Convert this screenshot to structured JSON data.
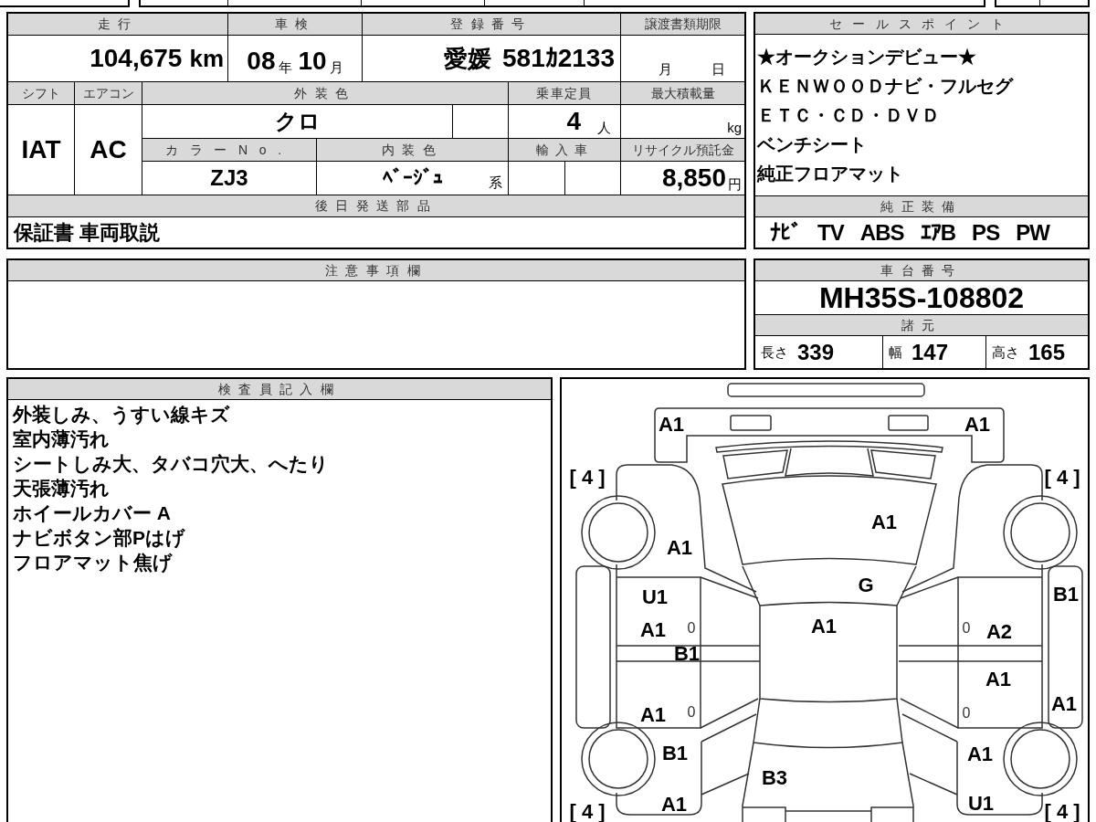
{
  "vehicle_table": {
    "mileage": {
      "label": "走行",
      "value": "104,675",
      "unit": "km"
    },
    "inspection": {
      "label": "車検",
      "year": "08",
      "year_unit": "年",
      "month": "10",
      "month_unit": "月"
    },
    "registration": {
      "label": "登録番号",
      "place": "愛媛",
      "number": "581ｶ2133"
    },
    "transfer_deadline": {
      "label": "譲渡書類期限",
      "month_unit": "月",
      "day_unit": "日"
    },
    "shift": {
      "label": "シフト",
      "value": "IAT"
    },
    "aircon": {
      "label": "エアコン",
      "value": "AC"
    },
    "exterior_color": {
      "label": "外装色",
      "value": "クロ"
    },
    "capacity": {
      "label": "乗車定員",
      "value": "4",
      "unit": "人"
    },
    "max_load": {
      "label": "最大積載量",
      "unit": "kg"
    },
    "color_no": {
      "label": "カラーNo.",
      "value": "ZJ3"
    },
    "interior_color": {
      "label": "内装色",
      "value": "ﾍﾞｰｼﾞｭ",
      "suffix": "系"
    },
    "imported": {
      "label": "輸入車"
    },
    "recycle_deposit": {
      "label": "リサイクル預託金",
      "value": "8,850",
      "unit": "円"
    },
    "later_shipment": {
      "label": "後日発送部品",
      "value": "保証書 車両取説"
    }
  },
  "sales_points": {
    "label": "セールスポイント",
    "lines": [
      "★オークションデビュー★",
      "ＫＥＮＷＯＯＤナビ・フルセグ",
      "ＥＴＣ・ＣＤ・ＤＶＤ",
      "ベンチシート",
      "純正フロアマット"
    ]
  },
  "standard_equipment": {
    "label": "純正装備",
    "items": [
      "ﾅﾋﾞ",
      "TV",
      "ABS",
      "ｴｱB",
      "PS",
      "PW"
    ]
  },
  "notes": {
    "label": "注意事項欄"
  },
  "chassis": {
    "label": "車台番号",
    "value": "MH35S-108802"
  },
  "specs": {
    "label": "諸元",
    "items": [
      {
        "label": "長さ",
        "value": "339"
      },
      {
        "label": "幅",
        "value": "147"
      },
      {
        "label": "高さ",
        "value": "165"
      }
    ]
  },
  "inspector_notes": {
    "label": "検査員記入欄",
    "lines": [
      "外装しみ、うすい線キズ",
      "室内薄汚れ",
      "シートしみ大、タバコ穴大、へたり",
      "天張薄汚れ",
      "ホイールカバー A",
      "ナビボタン部Pはげ",
      "フロアマット焦げ"
    ]
  },
  "damage_diagram": {
    "marks": [
      {
        "kind": "grade",
        "text": "A1"
      },
      {
        "kind": "grade",
        "text": "A1"
      },
      {
        "kind": "tread",
        "text": "[ 4 ]"
      },
      {
        "kind": "tread",
        "text": "[ 4 ]"
      },
      {
        "kind": "grade",
        "text": "A1"
      },
      {
        "kind": "grade",
        "text": "A1"
      },
      {
        "kind": "grade",
        "text": "G"
      },
      {
        "kind": "grade",
        "text": "U1"
      },
      {
        "kind": "grade",
        "text": "B1"
      },
      {
        "kind": "grade",
        "text": "A1"
      },
      {
        "kind": "note",
        "text": "0"
      },
      {
        "kind": "grade",
        "text": "A1"
      },
      {
        "kind": "note",
        "text": "0"
      },
      {
        "kind": "grade",
        "text": "A2"
      },
      {
        "kind": "grade",
        "text": "B1"
      },
      {
        "kind": "grade",
        "text": "A1"
      },
      {
        "kind": "grade",
        "text": "A1"
      },
      {
        "kind": "note",
        "text": "0"
      },
      {
        "kind": "note",
        "text": "0"
      },
      {
        "kind": "grade",
        "text": "A1"
      },
      {
        "kind": "grade",
        "text": "B1"
      },
      {
        "kind": "grade",
        "text": "A1"
      },
      {
        "kind": "grade",
        "text": "B3"
      },
      {
        "kind": "grade",
        "text": "A1"
      },
      {
        "kind": "grade",
        "text": "U1"
      },
      {
        "kind": "tread",
        "text": "[ 4 ]"
      },
      {
        "kind": "tread",
        "text": "[ 4 ]"
      }
    ]
  }
}
